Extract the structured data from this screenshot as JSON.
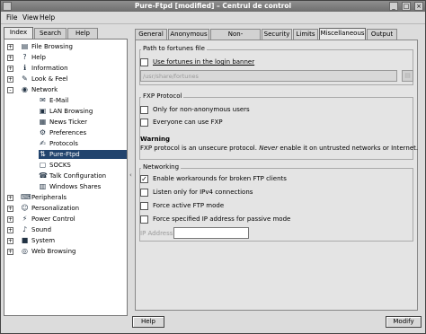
{
  "window": {
    "title": "Pure-Ftpd [modified] – Centrul de control"
  },
  "menu": {
    "file": "File",
    "view": "View",
    "help": "Help"
  },
  "left_tabs": [
    "Index",
    "Search",
    "Help"
  ],
  "tree": [
    {
      "label": "File Browsing",
      "level": 0,
      "expander": "+",
      "icon": "folder-icon",
      "glyph": "▤"
    },
    {
      "label": "Help",
      "level": 0,
      "expander": "+",
      "icon": "help-icon",
      "glyph": "?"
    },
    {
      "label": "Information",
      "level": 0,
      "expander": "+",
      "icon": "info-icon",
      "glyph": "ℹ"
    },
    {
      "label": "Look & Feel",
      "level": 0,
      "expander": "+",
      "icon": "paint-icon",
      "glyph": "✎"
    },
    {
      "label": "Network",
      "level": 0,
      "expander": "-",
      "icon": "network-icon",
      "glyph": "◉"
    },
    {
      "label": "E-Mail",
      "level": 1,
      "expander": "",
      "icon": "mail-icon",
      "glyph": "✉"
    },
    {
      "label": "LAN Browsing",
      "level": 1,
      "expander": "",
      "icon": "lan-icon",
      "glyph": "▣"
    },
    {
      "label": "News Ticker",
      "level": 1,
      "expander": "",
      "icon": "news-icon",
      "glyph": "▦"
    },
    {
      "label": "Preferences",
      "level": 1,
      "expander": "",
      "icon": "preferences-icon",
      "glyph": "⚙"
    },
    {
      "label": "Protocols",
      "level": 1,
      "expander": "",
      "icon": "protocols-icon",
      "glyph": "✍"
    },
    {
      "label": "Pure-Ftpd",
      "level": 1,
      "expander": "",
      "icon": "ftp-icon",
      "glyph": "⇅",
      "selected": true
    },
    {
      "label": "SOCKS",
      "level": 1,
      "expander": "",
      "icon": "socks-icon",
      "glyph": "▢"
    },
    {
      "label": "Talk Configuration",
      "level": 1,
      "expander": "",
      "icon": "talk-icon",
      "glyph": "☎"
    },
    {
      "label": "Windows Shares",
      "level": 1,
      "expander": "",
      "icon": "shares-icon",
      "glyph": "▥"
    },
    {
      "label": "Peripherals",
      "level": 0,
      "expander": "+",
      "icon": "peripherals-icon",
      "glyph": "⌨"
    },
    {
      "label": "Personalization",
      "level": 0,
      "expander": "+",
      "icon": "personalization-icon",
      "glyph": "☺"
    },
    {
      "label": "Power Control",
      "level": 0,
      "expander": "+",
      "icon": "power-icon",
      "glyph": "⚡"
    },
    {
      "label": "Sound",
      "level": 0,
      "expander": "+",
      "icon": "sound-icon",
      "glyph": "♪"
    },
    {
      "label": "System",
      "level": 0,
      "expander": "+",
      "icon": "system-icon",
      "glyph": "■"
    },
    {
      "label": "Web Browsing",
      "level": 0,
      "expander": "+",
      "icon": "web-icon",
      "glyph": "◎"
    }
  ],
  "right_tabs": [
    "General",
    "Anonymous",
    "Non-Anonymous",
    "Security",
    "Limits",
    "Miscellaneous",
    "Output"
  ],
  "active_right_tab": "Miscellaneous",
  "fortunes": {
    "title": "Path to fortunes file",
    "checkbox": "Use fortunes in the login banner",
    "checked": false,
    "path": "/usr/share/fortunes"
  },
  "fxp": {
    "title": "FXP Protocol",
    "opt1": "Only for non-anonymous users",
    "opt1_checked": false,
    "opt2": "Everyone can use FXP",
    "opt2_checked": false,
    "warning_title": "Warning",
    "warning_text_a": "FXP protocol is an unsecure protocol.",
    "warning_text_b": "Never",
    "warning_text_c": "enable it on untrusted networks or Internet."
  },
  "networking": {
    "title": "Networking",
    "opt1": "Enable workarounds for broken FTP clients",
    "opt1_checked": true,
    "opt2": "Listen only for IPv4 connections",
    "opt2_checked": false,
    "opt3": "Force active FTP mode",
    "opt3_checked": false,
    "opt4": "Force specified IP address for passive mode",
    "opt4_checked": false,
    "ip_label": "IP Address:",
    "ip_value": ""
  },
  "buttons": {
    "help": "Help",
    "modify": "Modify"
  }
}
